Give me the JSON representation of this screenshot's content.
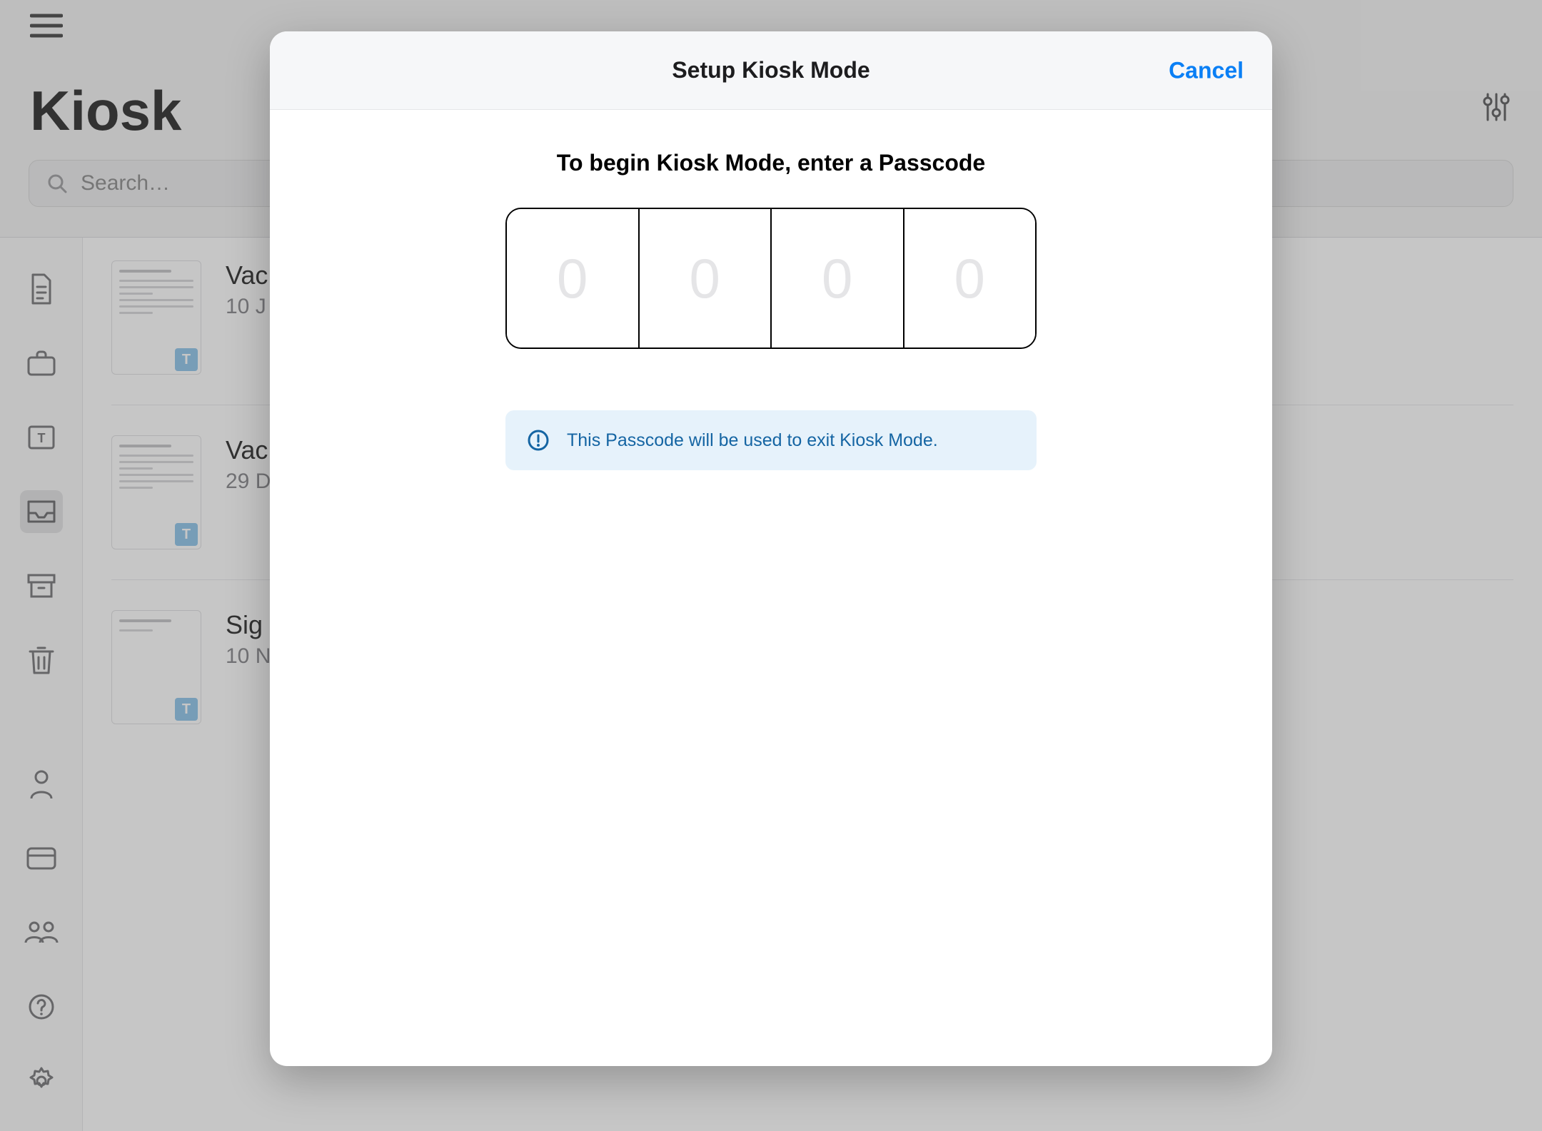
{
  "header": {
    "title": "Kiosk"
  },
  "search": {
    "placeholder": "Search…"
  },
  "sidebar": {
    "items": [
      {
        "name": "documents",
        "icon": "document-icon",
        "active": false
      },
      {
        "name": "briefcase",
        "icon": "briefcase-icon",
        "active": false
      },
      {
        "name": "templates",
        "icon": "template-box-icon",
        "active": false
      },
      {
        "name": "kiosk",
        "icon": "tray-icon",
        "active": true
      },
      {
        "name": "archive",
        "icon": "archive-icon",
        "active": false
      },
      {
        "name": "trash",
        "icon": "trash-icon",
        "active": false
      }
    ],
    "bottom_items": [
      {
        "name": "account",
        "icon": "person-icon"
      },
      {
        "name": "billing",
        "icon": "card-icon"
      },
      {
        "name": "team",
        "icon": "people-icon"
      },
      {
        "name": "help",
        "icon": "help-icon"
      },
      {
        "name": "settings",
        "icon": "gear-icon"
      }
    ]
  },
  "documents": [
    {
      "title": "Vac",
      "date": "10 J",
      "badge": "T"
    },
    {
      "title": "Vac",
      "date": "29 D",
      "badge": "T"
    },
    {
      "title": "Sig",
      "date": "10 N",
      "badge": "T"
    }
  ],
  "modal": {
    "title": "Setup Kiosk Mode",
    "cancel_label": "Cancel",
    "instruction": "To begin Kiosk Mode, enter a Passcode",
    "passcode_placeholder": "0",
    "info_text": "This Passcode will be used to exit Kiosk Mode."
  },
  "colors": {
    "accent_blue": "#0a7ff5",
    "info_bg": "#e6f2fb",
    "info_text": "#1565a3"
  }
}
